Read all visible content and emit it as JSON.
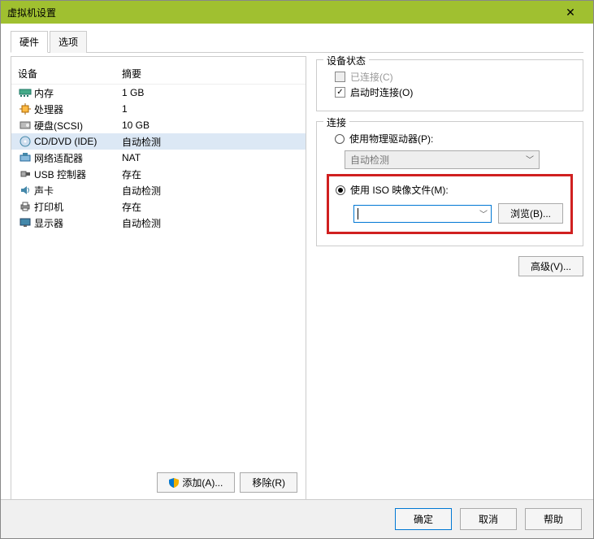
{
  "window": {
    "title": "虚拟机设置"
  },
  "tabs": {
    "hardware": "硬件",
    "options": "选项"
  },
  "list": {
    "header": {
      "device": "设备",
      "summary": "摘要"
    },
    "items": [
      {
        "device": "内存",
        "summary": "1 GB",
        "icon": "memory"
      },
      {
        "device": "处理器",
        "summary": "1",
        "icon": "cpu"
      },
      {
        "device": "硬盘(SCSI)",
        "summary": "10 GB",
        "icon": "hdd"
      },
      {
        "device": "CD/DVD (IDE)",
        "summary": "自动检测",
        "icon": "cd",
        "selected": true
      },
      {
        "device": "网络适配器",
        "summary": "NAT",
        "icon": "nic"
      },
      {
        "device": "USB 控制器",
        "summary": "存在",
        "icon": "usb"
      },
      {
        "device": "声卡",
        "summary": "自动检测",
        "icon": "sound"
      },
      {
        "device": "打印机",
        "summary": "存在",
        "icon": "printer"
      },
      {
        "device": "显示器",
        "summary": "自动检测",
        "icon": "display"
      }
    ]
  },
  "buttons": {
    "add": "添加(A)...",
    "remove": "移除(R)"
  },
  "status": {
    "legend": "设备状态",
    "connected": "已连接(C)",
    "connectAtPowerOn": "启动时连接(O)"
  },
  "connection": {
    "legend": "连接",
    "usePhysical": "使用物理驱动器(P):",
    "autoDetect": "自动检测",
    "useISO": "使用 ISO 映像文件(M):",
    "browse": "浏览(B)...",
    "advanced": "高级(V)..."
  },
  "footer": {
    "ok": "确定",
    "cancel": "取消",
    "help": "帮助"
  }
}
